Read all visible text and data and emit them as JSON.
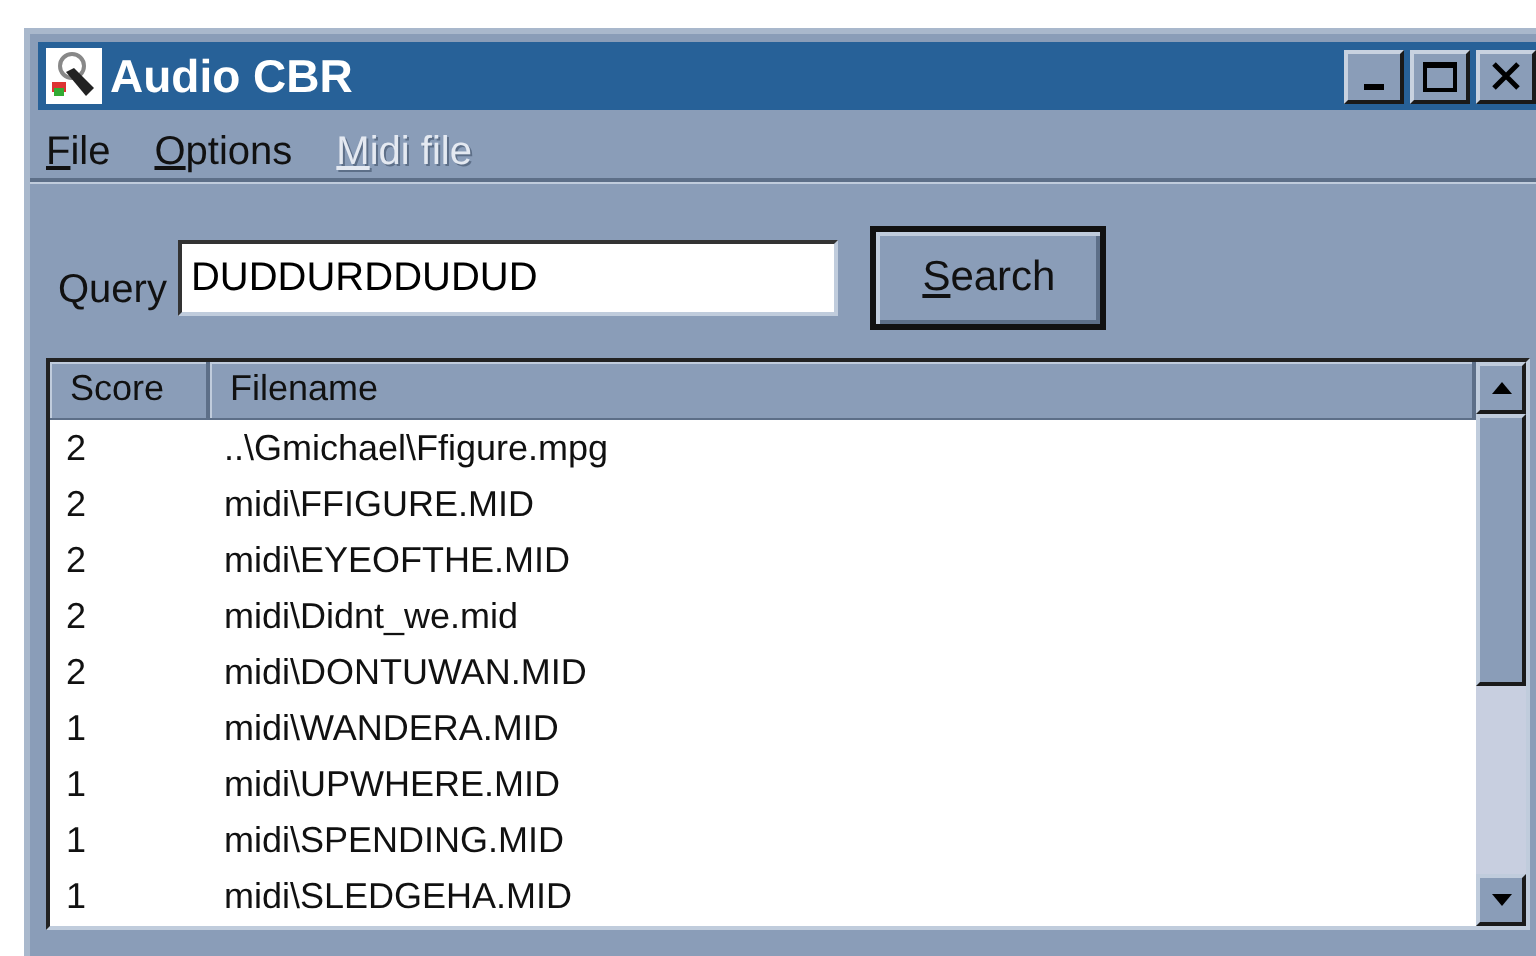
{
  "window": {
    "title": "Audio CBR"
  },
  "menu": [
    {
      "label": "File",
      "disabled": false
    },
    {
      "label": "Options",
      "disabled": false
    },
    {
      "label": "Midi file",
      "disabled": true
    }
  ],
  "query": {
    "label": "Query",
    "value": "DUDDURDDUDUD"
  },
  "search_button": "Search",
  "table": {
    "columns": [
      "Score",
      "Filename"
    ],
    "rows": [
      [
        "2",
        "..\\Gmichael\\Ffigure.mpg"
      ],
      [
        "2",
        "midi\\FFIGURE.MID"
      ],
      [
        "2",
        "midi\\EYEOFTHE.MID"
      ],
      [
        "2",
        "midi\\Didnt_we.mid"
      ],
      [
        "2",
        "midi\\DONTUWAN.MID"
      ],
      [
        "1",
        "midi\\WANDERA.MID"
      ],
      [
        "1",
        "midi\\UPWHERE.MID"
      ],
      [
        "1",
        "midi\\SPENDING.MID"
      ],
      [
        "1",
        "midi\\SLEDGEHA.MID"
      ]
    ]
  }
}
